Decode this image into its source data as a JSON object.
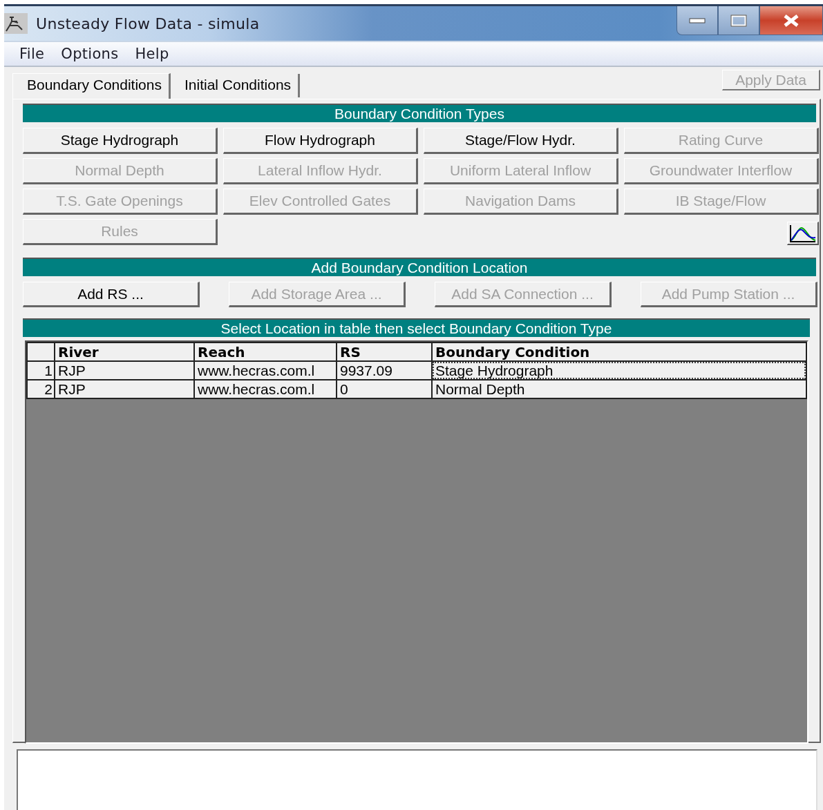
{
  "window": {
    "title": "Unsteady Flow Data - simula"
  },
  "menu": [
    "File",
    "Options",
    "Help"
  ],
  "tabs": [
    {
      "label": "Boundary Conditions",
      "selected": true
    },
    {
      "label": "Initial Conditions",
      "selected": false
    }
  ],
  "apply_button": {
    "label": "Apply Data",
    "disabled": true
  },
  "types_section": {
    "title": "Boundary Condition Types",
    "buttons": [
      {
        "label": "Stage Hydrograph",
        "disabled": false
      },
      {
        "label": "Flow Hydrograph",
        "disabled": false
      },
      {
        "label": "Stage/Flow Hydr.",
        "disabled": false
      },
      {
        "label": "Rating Curve",
        "disabled": true
      },
      {
        "label": "Normal Depth",
        "disabled": true
      },
      {
        "label": "Lateral Inflow Hydr.",
        "disabled": true
      },
      {
        "label": "Uniform Lateral Inflow",
        "disabled": true
      },
      {
        "label": "Groundwater Interflow",
        "disabled": true
      },
      {
        "label": "T.S. Gate Openings",
        "disabled": true
      },
      {
        "label": "Elev Controlled Gates",
        "disabled": true
      },
      {
        "label": "Navigation Dams",
        "disabled": true
      },
      {
        "label": "IB Stage/Flow",
        "disabled": true
      },
      {
        "label": "Rules",
        "disabled": true
      }
    ]
  },
  "location_section": {
    "title": "Add Boundary Condition Location",
    "buttons": [
      {
        "label": "Add RS ...",
        "disabled": false
      },
      {
        "label": "Add Storage Area ...",
        "disabled": true
      },
      {
        "label": "Add SA Connection ...",
        "disabled": true
      },
      {
        "label": "Add Pump Station ...",
        "disabled": true
      }
    ]
  },
  "table": {
    "title": "Select Location in table then select Boundary Condition Type",
    "columns": [
      "River",
      "Reach",
      "RS",
      "Boundary Condition"
    ],
    "rows": [
      {
        "number": "1",
        "cells": [
          "RJP",
          "www.hecras.com.l",
          "9937.09",
          "Stage Hydrograph"
        ],
        "selected": true
      },
      {
        "number": "2",
        "cells": [
          "RJP",
          "www.hecras.com.l",
          "0",
          "Normal Depth"
        ],
        "selected": false
      }
    ]
  }
}
